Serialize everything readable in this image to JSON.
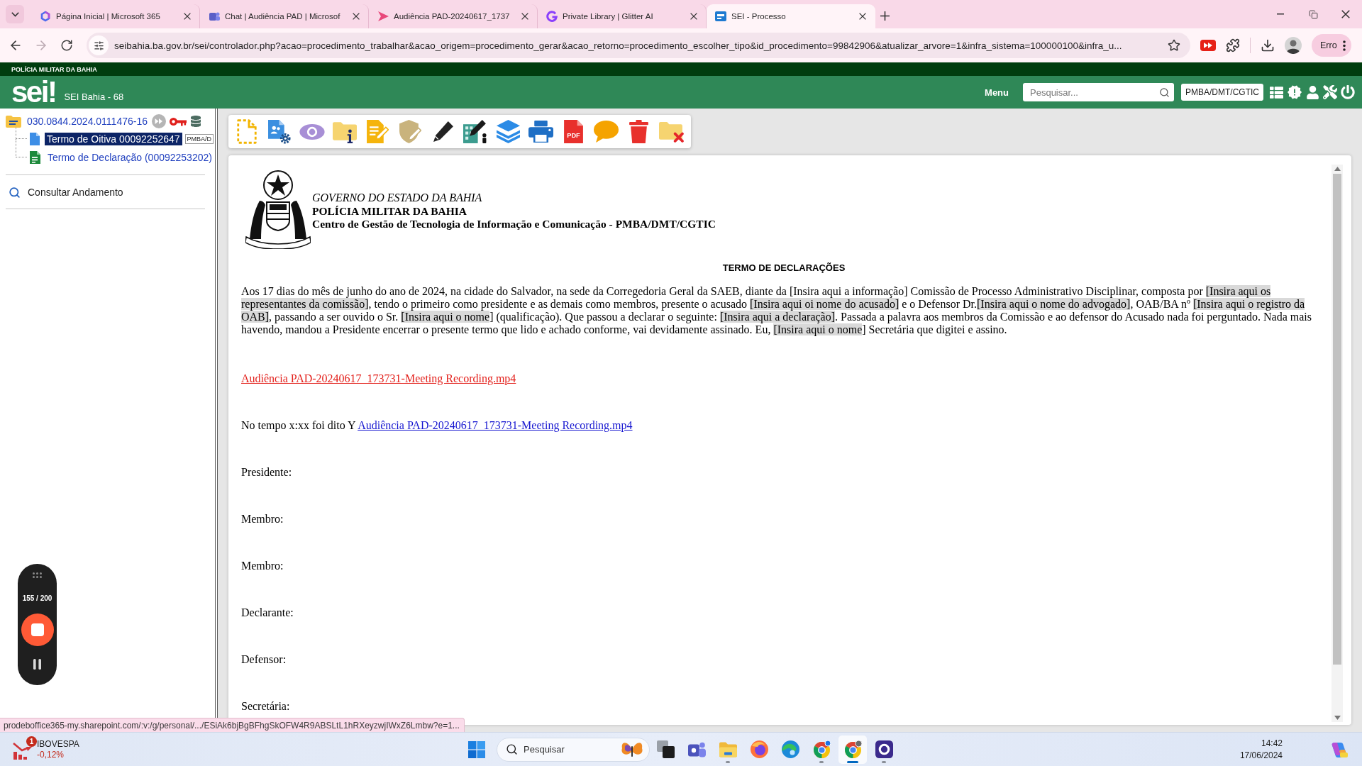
{
  "browser": {
    "tabs": [
      {
        "title": "Página Inicial | Microsoft 365",
        "selected": false
      },
      {
        "title": "Chat | Audiência PAD | Microsof",
        "selected": false
      },
      {
        "title": "Audiência PAD-20240617_1737",
        "selected": false
      },
      {
        "title": "Private Library | Glitter AI",
        "selected": false
      },
      {
        "title": "SEI - Processo",
        "selected": true
      }
    ],
    "back_disabled": false,
    "forward_disabled": true,
    "url": "seibahia.ba.gov.br/sei/controlador.php?acao=procedimento_trabalhar&acao_origem=procedimento_gerar&acao_retorno=procedimento_escolher_tipo&id_procedimento=99842906&atualizar_arvore=1&infra_sistema=100000100&infra_u...",
    "profile_status": "Erro"
  },
  "banner": {
    "title": "POLÍCIA MILITAR DA BAHIA"
  },
  "header": {
    "logo": "sei!",
    "app_name": "SEI Bahia - 68",
    "menu": "Menu",
    "search": {
      "placeholder": "Pesquisar..."
    },
    "unit": "PMBA/DMT/CGTIC"
  },
  "sidebar": {
    "process": "030.0844.2024.0111476-16",
    "documents": [
      {
        "kind": "internal",
        "title": "Termo de Oitiva 00092252647",
        "unit_tag": "PMBA/D",
        "selected": true
      },
      {
        "kind": "external",
        "title": "Termo de Declaração (00092253202)",
        "selected": false
      }
    ],
    "actions": [
      {
        "label": "Consultar Andamento"
      }
    ]
  },
  "toolbar": {
    "pdf_label": "PDF"
  },
  "document": {
    "letterhead": [
      {
        "kind": "italic",
        "text": "GOVERNO DO ESTADO DA BAHIA"
      },
      {
        "kind": "bold",
        "text": "POLÍCIA MILITAR DA BAHIA"
      },
      {
        "kind": "bold",
        "text": "Centro de Gestão de Tecnologia de Informação e Comunicação - PMBA/DMT/CGTIC"
      }
    ],
    "title": "TERMO DE DECLARAÇÕES",
    "body": [
      {
        "text": "Aos 17 dias do mês de junho do ano de 2024, na cidade do Salvador, na sede da Corregedoria Geral da SAEB, diante da [Insira aqui a informação] Comissão de Processo Administrativo Disciplinar, composta por ",
        "highlighted": false
      },
      {
        "text": "[Insira aqui os representantes da comissão]",
        "highlighted": true
      },
      {
        "text": ", tendo o primeiro como presidente e as demais como membros, presente o acusado ",
        "highlighted": false
      },
      {
        "text": "[Insira aqui oi nome do acusado]",
        "highlighted": true
      },
      {
        "text": " e o Defensor Dr.",
        "highlighted": false
      },
      {
        "text": "[Insira aqui o nome do advogado]",
        "highlighted": true
      },
      {
        "text": ", OAB/BA nº ",
        "highlighted": false
      },
      {
        "text": "[Insira aqui o registro da OAB]",
        "highlighted": true
      },
      {
        "text": ", passando a ser ouvido o Sr. ",
        "highlighted": false
      },
      {
        "text": "[Insira aqui o nome",
        "highlighted": true
      },
      {
        "text": "] (qualificação). Que passou a declarar o seguinte: ",
        "highlighted": false
      },
      {
        "text": "[Insira aqui a declaração]",
        "highlighted": true
      },
      {
        "text": ". Passada a palavra aos membros da Comissão e ao defensor do Acusado nada foi perguntado. Nada mais havendo, mandou a Presidente encerrar o presente termo que lido e achado conforme, vai devidamente assinado. Eu, ",
        "highlighted": false
      },
      {
        "text": "[Insira aqui o nome",
        "highlighted": true
      },
      {
        "text": "] Secretária que digitei e assino.",
        "highlighted": false
      }
    ],
    "recording_link": {
      "text": "Audiência PAD-20240617_173731-Meeting Recording.mp4",
      "visited": true
    },
    "statement": {
      "text": "No tempo x:xx foi dito Y",
      "link": {
        "text": "Audiência PAD-20240617_173731-Meeting Recording.mp4",
        "visited": false
      }
    },
    "signatures": [
      "Presidente:",
      "Membro:",
      "Membro:",
      "Declarante:",
      "Defensor:",
      "Secretária:"
    ]
  },
  "recorder": {
    "count": "155 / 200"
  },
  "status_url": "prodeboffice365-my.sharepoint.com/:v:/g/personal/.../ESiAk6bjBgBFhgSkOFW4R9ABSLtL1hRXeyzwjIWxZ6Lmbw?e=1...",
  "taskbar": {
    "widget": {
      "title": "IBOVESPA",
      "change": "-0,12%",
      "badge": "1"
    },
    "search": {
      "placeholder": "Pesquisar"
    },
    "apps": [
      {
        "running": false,
        "selected": false
      },
      {
        "running": false,
        "selected": false
      },
      {
        "running": true,
        "selected": false
      },
      {
        "running": false,
        "selected": false
      },
      {
        "running": false,
        "selected": false
      },
      {
        "running": true,
        "selected": false
      },
      {
        "running": true,
        "selected": true
      },
      {
        "running": true,
        "selected": false
      }
    ],
    "time": "14:42",
    "date": "17/06/2024"
  }
}
